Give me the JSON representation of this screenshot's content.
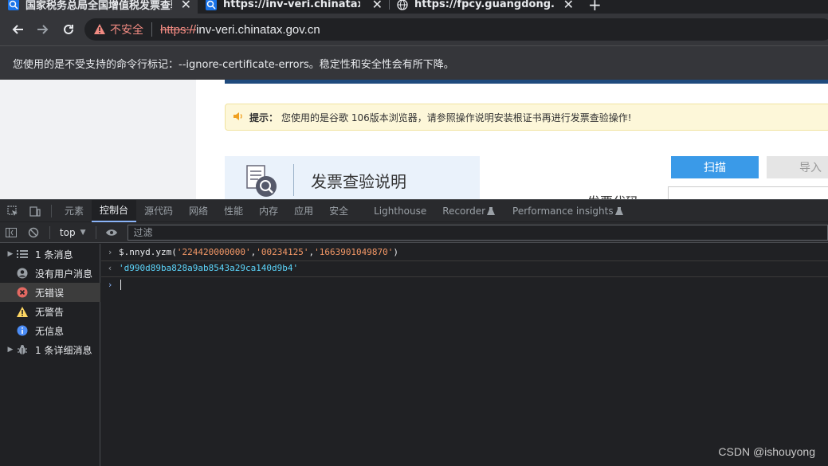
{
  "browser": {
    "tabs": [
      {
        "title": "国家税务总局全国增值税发票查验平台",
        "active": true
      },
      {
        "title": "https://inv-veri.chinatax.gov.cn",
        "active": false
      },
      {
        "title": "https://fpcy.guangdong.chinatax.gov.cn",
        "active": false
      }
    ],
    "new_tab_label": "+",
    "close_label": "✕",
    "security_label": "不安全",
    "url_scheme": "https://",
    "url_host": "inv-veri.chinatax.gov.cn",
    "infobar_text": "您使用的是不受支持的命令行标记：--ignore-certificate-errors。稳定性和安全性会有所下降。"
  },
  "page": {
    "notice_label": "提示：",
    "notice_text": "您使用的是谷歌 106版本浏览器，请参照操作说明安装根证书再进行发票查验操作!",
    "guide_title": "发票查验说明",
    "scan_label": "扫描",
    "import_label": "导入",
    "invoice_code_label": "发票代码"
  },
  "devtools": {
    "tabs": [
      "元素",
      "控制台",
      "源代码",
      "网络",
      "性能",
      "内存",
      "应用",
      "安全",
      "Lighthouse",
      "Recorder",
      "Performance insights"
    ],
    "active_tab": "控制台",
    "context": "top",
    "filter_placeholder": "过滤",
    "sidebar": [
      {
        "label": "1 条消息",
        "icon": "list-icon",
        "expandable": true
      },
      {
        "label": "没有用户消息",
        "icon": "user-icon",
        "expandable": false
      },
      {
        "label": "无错误",
        "icon": "error-icon",
        "expandable": false,
        "selected": true
      },
      {
        "label": "无警告",
        "icon": "warning-icon",
        "expandable": false
      },
      {
        "label": "无信息",
        "icon": "info-icon",
        "expandable": false
      },
      {
        "label": "1 条详细消息",
        "icon": "bug-icon",
        "expandable": true
      }
    ],
    "console": {
      "input_prefix": "$.",
      "input_obj": "nnyd",
      "input_fn": "yzm",
      "arg1": "'224420000000'",
      "arg2": "'00234125'",
      "arg3": "'1663901049870'",
      "result": "'d990d89ba828a9ab8543a29ca140d9b4'"
    }
  },
  "watermark": "CSDN @ishouyong",
  "colors": {
    "accent": "#8ab4f8",
    "scan_button": "#3a9ae8",
    "insecure": "#f28b82",
    "string": "#f29766",
    "result": "#5cd5fb"
  }
}
